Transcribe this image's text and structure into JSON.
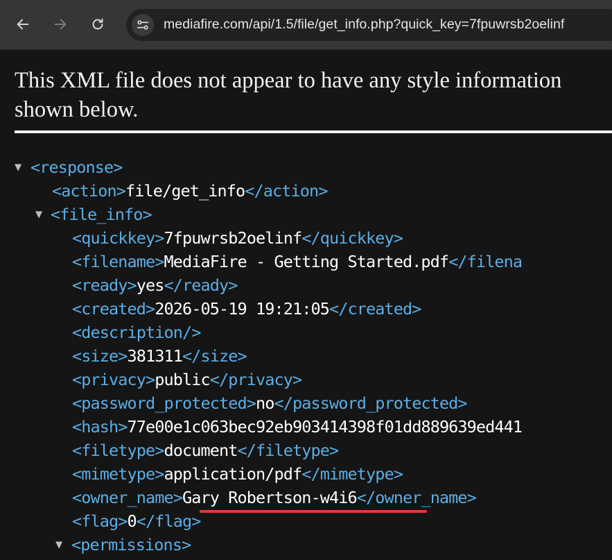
{
  "browser": {
    "url": "mediafire.com/api/1.5/file/get_info.php?quick_key=7fpuwrsb2oelinf",
    "icons": [
      "back-arrow-icon",
      "forward-arrow-icon",
      "reload-icon",
      "site-settings-icon"
    ]
  },
  "notice": {
    "line1": "This XML file does not appear to have any style information",
    "line2": "shown below."
  },
  "xml": {
    "response_open": "<response>",
    "action_open": "<action>",
    "action_value": "file/get_info",
    "action_close": "</action>",
    "file_info_open": "<file_info>",
    "fields": [
      {
        "open": "<quickkey>",
        "value": "7fpuwrsb2oelinf",
        "close": "</quickkey>"
      },
      {
        "open": "<filename>",
        "value": "MediaFire - Getting Started.pdf",
        "close": "</filena"
      },
      {
        "open": "<ready>",
        "value": "yes",
        "close": "</ready>"
      },
      {
        "open": "<created>",
        "value": "2026-05-19 19:21:05",
        "close": "</created>"
      },
      {
        "open": "<description/>",
        "value": "",
        "close": ""
      },
      {
        "open": "<size>",
        "value": "381311",
        "close": "</size>"
      },
      {
        "open": "<privacy>",
        "value": "public",
        "close": "</privacy>"
      },
      {
        "open": "<password_protected>",
        "value": "no",
        "close": "</password_protected>"
      },
      {
        "open": "<hash>",
        "value": "77e00e1c063bec92eb903414398f01dd889639ed441",
        "close": ""
      },
      {
        "open": "<filetype>",
        "value": "document",
        "close": "</filetype>"
      },
      {
        "open": "<mimetype>",
        "value": "application/pdf",
        "close": "</mimetype>"
      },
      {
        "open": "<owner_name>",
        "value": "Gary Robertson-w4i6",
        "close": "</owner_name>"
      },
      {
        "open": "<flag>",
        "value": "0",
        "close": "</flag>"
      }
    ],
    "permissions_open": "<permissions>"
  },
  "colors": {
    "tag": "#5aaee6",
    "text": "#ffffff",
    "underline": "#e33a3a",
    "background": "#151515",
    "toolbar": "#363636"
  }
}
